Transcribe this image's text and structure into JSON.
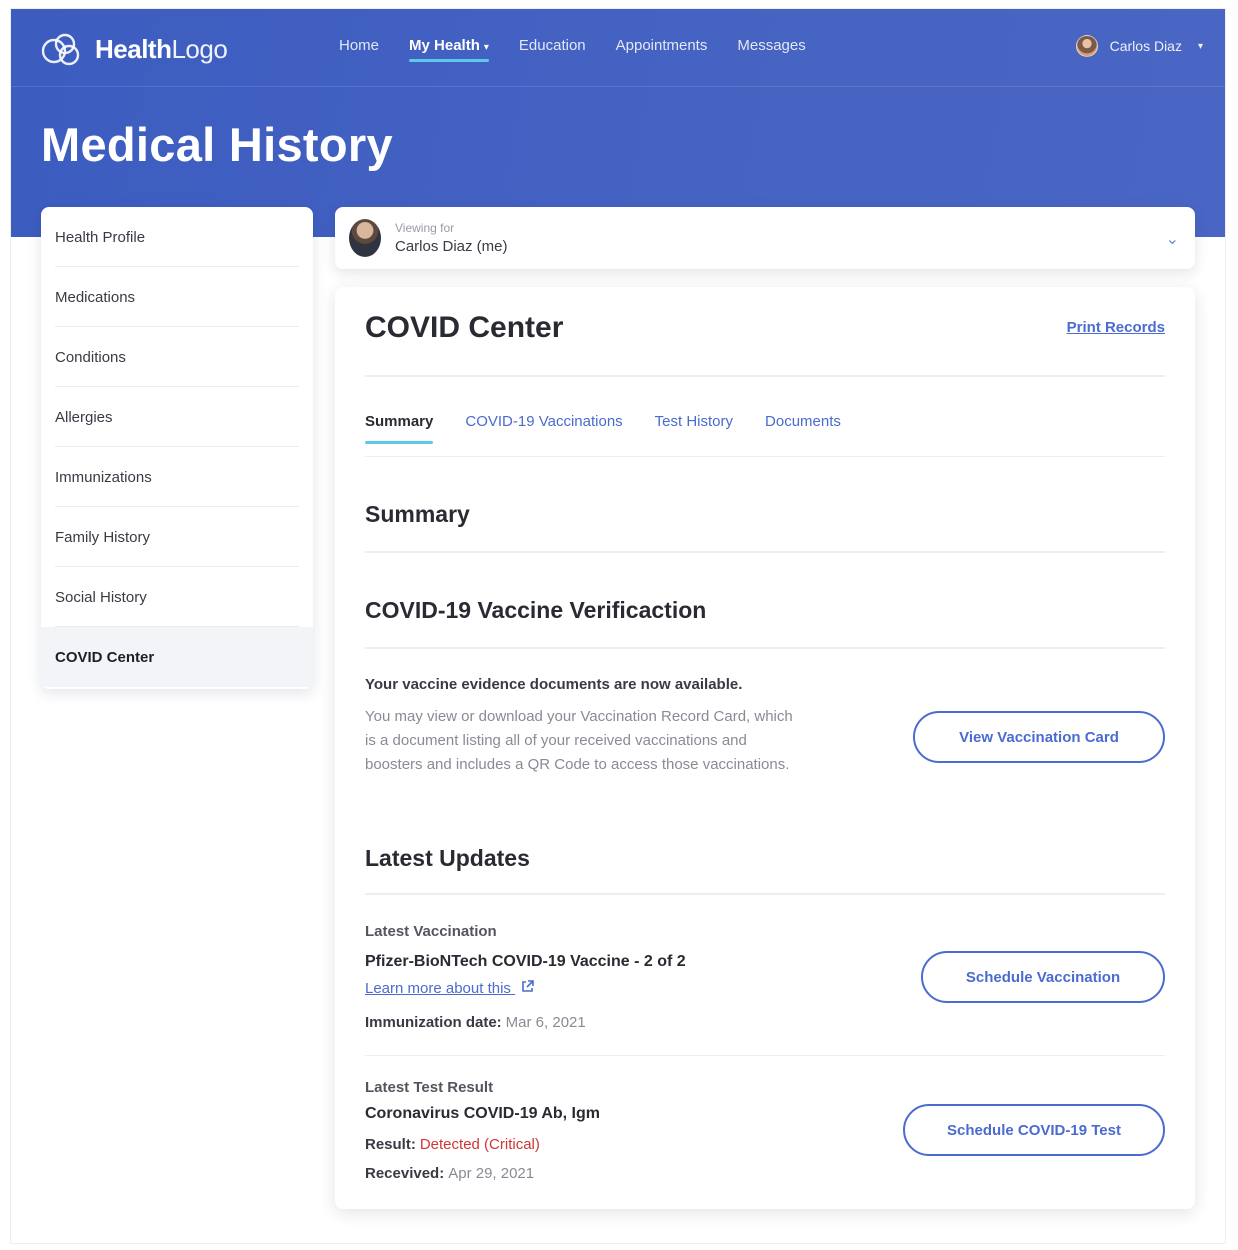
{
  "nav": {
    "logo_bold": "Health",
    "logo_light": "Logo",
    "links": [
      {
        "label": "Home"
      },
      {
        "label": "My Health"
      },
      {
        "label": "Education"
      },
      {
        "label": "Appointments"
      },
      {
        "label": "Messages"
      }
    ],
    "active_link": "My Health",
    "user_name": "Carlos Diaz"
  },
  "page": {
    "title": "Medical History"
  },
  "sidebar": {
    "items": [
      {
        "label": "Health Profile"
      },
      {
        "label": "Medications"
      },
      {
        "label": "Conditions"
      },
      {
        "label": "Allergies"
      },
      {
        "label": "Immunizations"
      },
      {
        "label": "Family History"
      },
      {
        "label": "Social History"
      },
      {
        "label": "COVID Center"
      }
    ],
    "active_item": "COVID Center"
  },
  "viewing": {
    "label": "Viewing for",
    "name": "Carlos Diaz (me)"
  },
  "card": {
    "title": "COVID Center",
    "print_label": "Print Records",
    "tabs": [
      {
        "label": "Summary"
      },
      {
        "label": "COVID-19 Vaccinations"
      },
      {
        "label": "Test History"
      },
      {
        "label": "Documents"
      }
    ],
    "active_tab": "Summary",
    "summary_heading": "Summary",
    "verification": {
      "heading": "COVID-19 Vaccine Verificaction",
      "notice": "Your vaccine evidence documents are now available.",
      "description": "You may view or download your Vaccination Record Card, which is a document listing all of your received vaccinations and boosters and includes a QR Code to access those vaccinations.",
      "button": "View Vaccination Card"
    },
    "updates": {
      "heading": "Latest Updates",
      "vaccination": {
        "label": "Latest Vaccination",
        "title": "Pfizer-BioNTech COVID-19 Vaccine - 2 of 2",
        "link": "Learn more about this",
        "date_key": "Immunization date:",
        "date_value": "Mar 6, 2021",
        "button": "Schedule Vaccination"
      },
      "test": {
        "label": "Latest Test Result",
        "title": "Coronavirus COVID-19 Ab, Igm",
        "result_key": "Result:",
        "result_value": "Detected (Critical)",
        "received_key": "Recevived:",
        "received_value": "Apr 29, 2021",
        "button": "Schedule COVID-19 Test"
      }
    }
  },
  "colors": {
    "header_blue": "#4563c2",
    "accent_blue": "#4a6bd0",
    "tab_underline": "#5ec8e8",
    "critical_red": "#d03535"
  },
  "icons": {
    "logo": "overlapping-circles-logo-icon",
    "external_link": "external-link-icon",
    "chevron": "chevron-down-icon"
  }
}
